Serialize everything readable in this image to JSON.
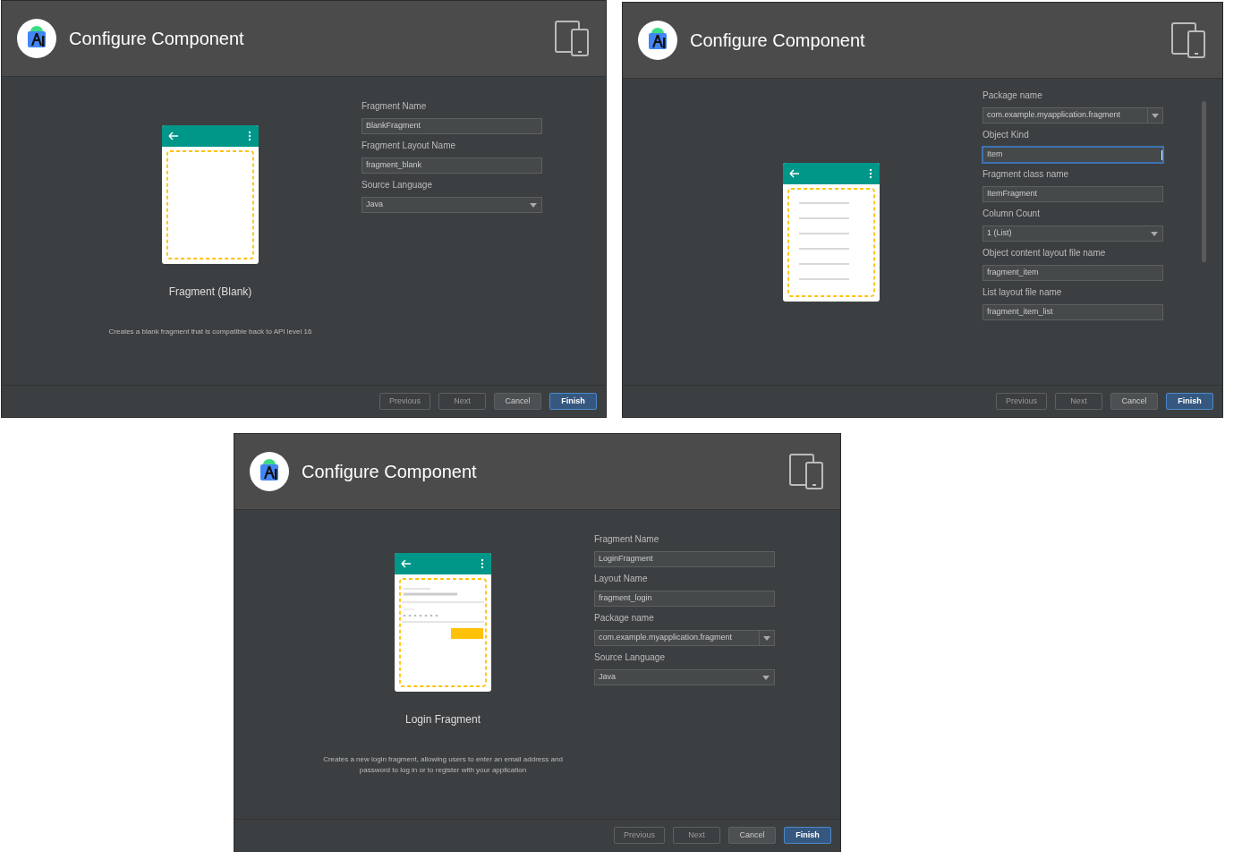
{
  "dialogs": [
    {
      "title": "Configure Component",
      "scrollable": false,
      "template": {
        "kind": "blank",
        "name": "Fragment (Blank)",
        "description": "Creates a blank fragment that is compatible back to API level 16"
      },
      "fields": [
        {
          "label": "Fragment Name",
          "kind": "text",
          "value": "BlankFragment",
          "focused": false
        },
        {
          "label": "Fragment Layout Name",
          "kind": "text",
          "value": "fragment_blank",
          "focused": false
        },
        {
          "label": "Source Language",
          "kind": "dropdown",
          "value": "Java",
          "focused": false
        }
      ],
      "buttons": [
        {
          "label": "Previous",
          "disabled": true,
          "primary": false
        },
        {
          "label": "Next",
          "disabled": true,
          "primary": false
        },
        {
          "label": "Cancel",
          "disabled": false,
          "primary": false
        },
        {
          "label": "Finish",
          "disabled": false,
          "primary": true
        }
      ]
    },
    {
      "title": "Configure Component",
      "scrollable": true,
      "template": {
        "kind": "list"
      },
      "fields": [
        {
          "label": "Package name",
          "kind": "combo",
          "value": "com.example.myapplication.fragment",
          "focused": false
        },
        {
          "label": "Object Kind",
          "kind": "text",
          "value": "Item",
          "focused": true
        },
        {
          "label": "Fragment class name",
          "kind": "text",
          "value": "ItemFragment",
          "focused": false
        },
        {
          "label": "Column Count",
          "kind": "dropdown",
          "value": "1 (List)",
          "focused": false
        },
        {
          "label": "Object content layout file name",
          "kind": "text",
          "value": "fragment_item",
          "focused": false
        },
        {
          "label": "List layout file name",
          "kind": "text",
          "value": "fragment_item_list",
          "focused": false
        }
      ],
      "buttons": [
        {
          "label": "Previous",
          "disabled": true,
          "primary": false
        },
        {
          "label": "Next",
          "disabled": true,
          "primary": false
        },
        {
          "label": "Cancel",
          "disabled": false,
          "primary": false
        },
        {
          "label": "Finish",
          "disabled": false,
          "primary": true
        }
      ]
    },
    {
      "title": "Configure Component",
      "scrollable": false,
      "template": {
        "kind": "login",
        "name": "Login Fragment",
        "description": "Creates a new login fragment, allowing users to enter an email address and password to log in or to register with your application"
      },
      "fields": [
        {
          "label": "Fragment Name",
          "kind": "text",
          "value": "LoginFragment",
          "focused": false
        },
        {
          "label": "Layout Name",
          "kind": "text",
          "value": "fragment_login",
          "focused": false
        },
        {
          "label": "Package name",
          "kind": "combo",
          "value": "com.example.myapplication.fragment",
          "focused": false
        },
        {
          "label": "Source Language",
          "kind": "dropdown",
          "value": "Java",
          "focused": false
        }
      ],
      "buttons": [
        {
          "label": "Previous",
          "disabled": true,
          "primary": false
        },
        {
          "label": "Next",
          "disabled": true,
          "primary": false
        },
        {
          "label": "Cancel",
          "disabled": false,
          "primary": false
        },
        {
          "label": "Finish",
          "disabled": false,
          "primary": true
        }
      ]
    }
  ]
}
